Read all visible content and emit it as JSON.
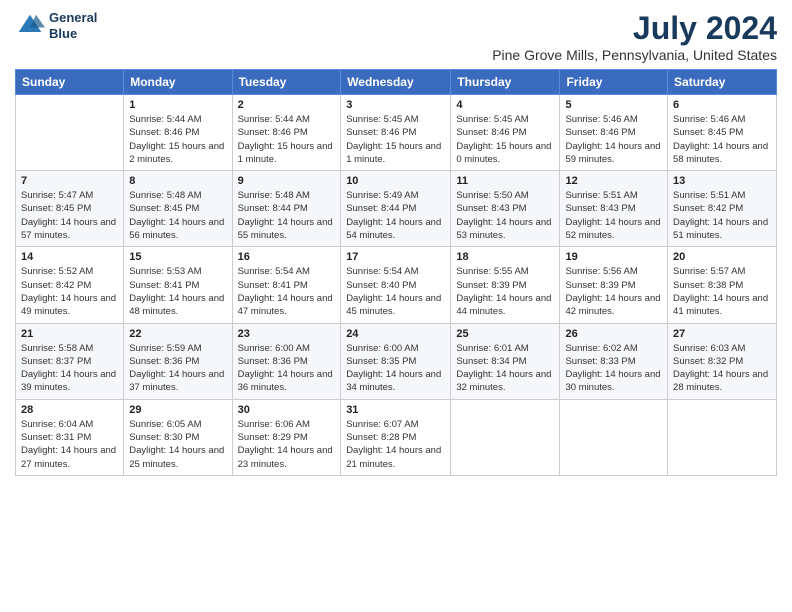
{
  "logo": {
    "line1": "General",
    "line2": "Blue"
  },
  "title": "July 2024",
  "subtitle": "Pine Grove Mills, Pennsylvania, United States",
  "days": [
    "Sunday",
    "Monday",
    "Tuesday",
    "Wednesday",
    "Thursday",
    "Friday",
    "Saturday"
  ],
  "weeks": [
    [
      {
        "date": "",
        "sunrise": "",
        "sunset": "",
        "daylight": ""
      },
      {
        "date": "1",
        "sunrise": "Sunrise: 5:44 AM",
        "sunset": "Sunset: 8:46 PM",
        "daylight": "Daylight: 15 hours and 2 minutes."
      },
      {
        "date": "2",
        "sunrise": "Sunrise: 5:44 AM",
        "sunset": "Sunset: 8:46 PM",
        "daylight": "Daylight: 15 hours and 1 minute."
      },
      {
        "date": "3",
        "sunrise": "Sunrise: 5:45 AM",
        "sunset": "Sunset: 8:46 PM",
        "daylight": "Daylight: 15 hours and 1 minute."
      },
      {
        "date": "4",
        "sunrise": "Sunrise: 5:45 AM",
        "sunset": "Sunset: 8:46 PM",
        "daylight": "Daylight: 15 hours and 0 minutes."
      },
      {
        "date": "5",
        "sunrise": "Sunrise: 5:46 AM",
        "sunset": "Sunset: 8:46 PM",
        "daylight": "Daylight: 14 hours and 59 minutes."
      },
      {
        "date": "6",
        "sunrise": "Sunrise: 5:46 AM",
        "sunset": "Sunset: 8:45 PM",
        "daylight": "Daylight: 14 hours and 58 minutes."
      }
    ],
    [
      {
        "date": "7",
        "sunrise": "Sunrise: 5:47 AM",
        "sunset": "Sunset: 8:45 PM",
        "daylight": "Daylight: 14 hours and 57 minutes."
      },
      {
        "date": "8",
        "sunrise": "Sunrise: 5:48 AM",
        "sunset": "Sunset: 8:45 PM",
        "daylight": "Daylight: 14 hours and 56 minutes."
      },
      {
        "date": "9",
        "sunrise": "Sunrise: 5:48 AM",
        "sunset": "Sunset: 8:44 PM",
        "daylight": "Daylight: 14 hours and 55 minutes."
      },
      {
        "date": "10",
        "sunrise": "Sunrise: 5:49 AM",
        "sunset": "Sunset: 8:44 PM",
        "daylight": "Daylight: 14 hours and 54 minutes."
      },
      {
        "date": "11",
        "sunrise": "Sunrise: 5:50 AM",
        "sunset": "Sunset: 8:43 PM",
        "daylight": "Daylight: 14 hours and 53 minutes."
      },
      {
        "date": "12",
        "sunrise": "Sunrise: 5:51 AM",
        "sunset": "Sunset: 8:43 PM",
        "daylight": "Daylight: 14 hours and 52 minutes."
      },
      {
        "date": "13",
        "sunrise": "Sunrise: 5:51 AM",
        "sunset": "Sunset: 8:42 PM",
        "daylight": "Daylight: 14 hours and 51 minutes."
      }
    ],
    [
      {
        "date": "14",
        "sunrise": "Sunrise: 5:52 AM",
        "sunset": "Sunset: 8:42 PM",
        "daylight": "Daylight: 14 hours and 49 minutes."
      },
      {
        "date": "15",
        "sunrise": "Sunrise: 5:53 AM",
        "sunset": "Sunset: 8:41 PM",
        "daylight": "Daylight: 14 hours and 48 minutes."
      },
      {
        "date": "16",
        "sunrise": "Sunrise: 5:54 AM",
        "sunset": "Sunset: 8:41 PM",
        "daylight": "Daylight: 14 hours and 47 minutes."
      },
      {
        "date": "17",
        "sunrise": "Sunrise: 5:54 AM",
        "sunset": "Sunset: 8:40 PM",
        "daylight": "Daylight: 14 hours and 45 minutes."
      },
      {
        "date": "18",
        "sunrise": "Sunrise: 5:55 AM",
        "sunset": "Sunset: 8:39 PM",
        "daylight": "Daylight: 14 hours and 44 minutes."
      },
      {
        "date": "19",
        "sunrise": "Sunrise: 5:56 AM",
        "sunset": "Sunset: 8:39 PM",
        "daylight": "Daylight: 14 hours and 42 minutes."
      },
      {
        "date": "20",
        "sunrise": "Sunrise: 5:57 AM",
        "sunset": "Sunset: 8:38 PM",
        "daylight": "Daylight: 14 hours and 41 minutes."
      }
    ],
    [
      {
        "date": "21",
        "sunrise": "Sunrise: 5:58 AM",
        "sunset": "Sunset: 8:37 PM",
        "daylight": "Daylight: 14 hours and 39 minutes."
      },
      {
        "date": "22",
        "sunrise": "Sunrise: 5:59 AM",
        "sunset": "Sunset: 8:36 PM",
        "daylight": "Daylight: 14 hours and 37 minutes."
      },
      {
        "date": "23",
        "sunrise": "Sunrise: 6:00 AM",
        "sunset": "Sunset: 8:36 PM",
        "daylight": "Daylight: 14 hours and 36 minutes."
      },
      {
        "date": "24",
        "sunrise": "Sunrise: 6:00 AM",
        "sunset": "Sunset: 8:35 PM",
        "daylight": "Daylight: 14 hours and 34 minutes."
      },
      {
        "date": "25",
        "sunrise": "Sunrise: 6:01 AM",
        "sunset": "Sunset: 8:34 PM",
        "daylight": "Daylight: 14 hours and 32 minutes."
      },
      {
        "date": "26",
        "sunrise": "Sunrise: 6:02 AM",
        "sunset": "Sunset: 8:33 PM",
        "daylight": "Daylight: 14 hours and 30 minutes."
      },
      {
        "date": "27",
        "sunrise": "Sunrise: 6:03 AM",
        "sunset": "Sunset: 8:32 PM",
        "daylight": "Daylight: 14 hours and 28 minutes."
      }
    ],
    [
      {
        "date": "28",
        "sunrise": "Sunrise: 6:04 AM",
        "sunset": "Sunset: 8:31 PM",
        "daylight": "Daylight: 14 hours and 27 minutes."
      },
      {
        "date": "29",
        "sunrise": "Sunrise: 6:05 AM",
        "sunset": "Sunset: 8:30 PM",
        "daylight": "Daylight: 14 hours and 25 minutes."
      },
      {
        "date": "30",
        "sunrise": "Sunrise: 6:06 AM",
        "sunset": "Sunset: 8:29 PM",
        "daylight": "Daylight: 14 hours and 23 minutes."
      },
      {
        "date": "31",
        "sunrise": "Sunrise: 6:07 AM",
        "sunset": "Sunset: 8:28 PM",
        "daylight": "Daylight: 14 hours and 21 minutes."
      },
      {
        "date": "",
        "sunrise": "",
        "sunset": "",
        "daylight": ""
      },
      {
        "date": "",
        "sunrise": "",
        "sunset": "",
        "daylight": ""
      },
      {
        "date": "",
        "sunrise": "",
        "sunset": "",
        "daylight": ""
      }
    ]
  ]
}
